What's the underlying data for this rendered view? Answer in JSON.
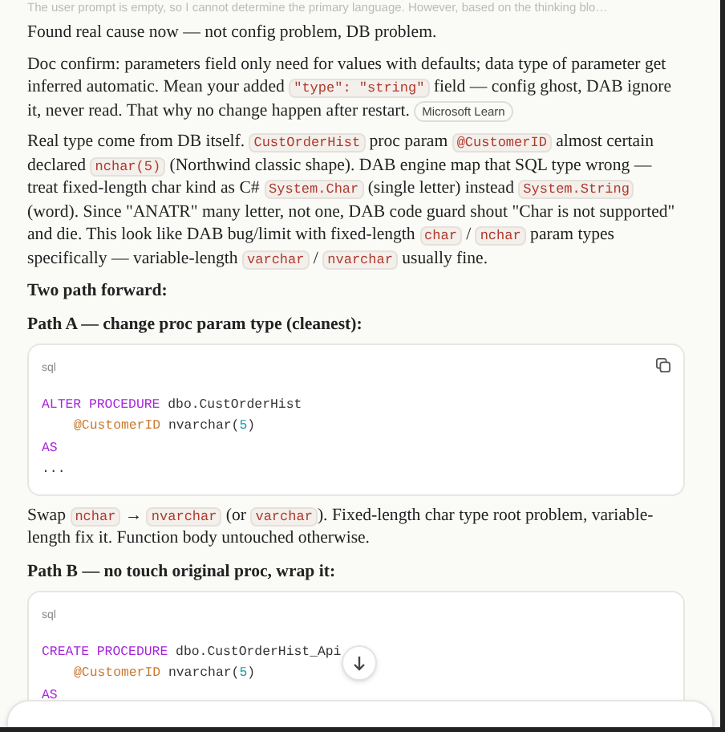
{
  "faded_line": "The user prompt is empty, so I cannot determine the primary language. However, based on the thinking blo…",
  "blocks": [
    {
      "kind": "para",
      "segments": [
        {
          "kind": "text",
          "text": "Found real cause now — not config problem, DB problem."
        }
      ]
    },
    {
      "kind": "para",
      "segments": [
        {
          "kind": "text",
          "text": "Doc confirm: parameters field only need for values with defaults; data type of parameter get inferred automatic. Mean your added "
        },
        {
          "kind": "code",
          "text": "\"type\": \"string\""
        },
        {
          "kind": "text",
          "text": " field — config ghost, DAB ignore it, never read. That why no change happen after restart. "
        },
        {
          "kind": "source",
          "text": "Microsoft Learn"
        }
      ]
    },
    {
      "kind": "para",
      "segments": [
        {
          "kind": "text",
          "text": "Real type come from DB itself. "
        },
        {
          "kind": "code",
          "text": "CustOrderHist"
        },
        {
          "kind": "text",
          "text": " proc param "
        },
        {
          "kind": "code",
          "text": "@CustomerID"
        },
        {
          "kind": "text",
          "text": " almost certain declared "
        },
        {
          "kind": "code",
          "text": "nchar(5)"
        },
        {
          "kind": "text",
          "text": " (Northwind classic shape). DAB engine map that SQL type wrong — treat fixed-length char kind as C# "
        },
        {
          "kind": "code",
          "text": "System.Char"
        },
        {
          "kind": "text",
          "text": " (single letter) instead "
        },
        {
          "kind": "code",
          "text": "System.String"
        },
        {
          "kind": "text",
          "text": " (word). Since \"ANATR\" many letter, not one, DAB code guard shout \"Char is not supported\" and die. This look like DAB bug/limit with fixed-length "
        },
        {
          "kind": "code",
          "text": "char"
        },
        {
          "kind": "text",
          "text": " / "
        },
        {
          "kind": "code",
          "text": "nchar"
        },
        {
          "kind": "text",
          "text": " param types specifically — variable-length "
        },
        {
          "kind": "code",
          "text": "varchar"
        },
        {
          "kind": "text",
          "text": " / "
        },
        {
          "kind": "code",
          "text": "nvarchar"
        },
        {
          "kind": "text",
          "text": " usually fine."
        }
      ]
    },
    {
      "kind": "heading",
      "text": "Two path forward:"
    },
    {
      "kind": "heading",
      "text": "Path A — change proc param type (cleanest):"
    },
    {
      "kind": "code_block",
      "language": "sql",
      "copy": true,
      "lines": [
        {
          "indent": false,
          "tokens": [
            {
              "kind": "keyword",
              "text": "ALTER PROCEDURE"
            },
            {
              "kind": "plain",
              "text": " dbo.CustOrderHist"
            }
          ]
        },
        {
          "indent": true,
          "tokens": [
            {
              "kind": "param",
              "text": "@CustomerID"
            },
            {
              "kind": "plain",
              "text": " nvarchar("
            },
            {
              "kind": "number",
              "text": "5"
            },
            {
              "kind": "plain",
              "text": ")"
            }
          ]
        },
        {
          "indent": false,
          "tokens": [
            {
              "kind": "keyword",
              "text": "AS"
            }
          ]
        },
        {
          "indent": false,
          "tokens": [
            {
              "kind": "plain",
              "text": "..."
            }
          ]
        }
      ]
    },
    {
      "kind": "para",
      "segments": [
        {
          "kind": "text",
          "text": "Swap "
        },
        {
          "kind": "code",
          "text": "nchar"
        },
        {
          "kind": "text",
          "text": " → "
        },
        {
          "kind": "code",
          "text": "nvarchar"
        },
        {
          "kind": "text",
          "text": " (or "
        },
        {
          "kind": "code",
          "text": "varchar"
        },
        {
          "kind": "text",
          "text": "). Fixed-length char type root problem, variable-length fix it. Function body untouched otherwise."
        }
      ]
    },
    {
      "kind": "heading",
      "text": "Path B — no touch original proc, wrap it:"
    },
    {
      "kind": "code_block",
      "language": "sql",
      "copy": false,
      "lines": [
        {
          "indent": false,
          "tokens": [
            {
              "kind": "keyword",
              "text": "CREATE PROCEDURE"
            },
            {
              "kind": "plain",
              "text": " dbo.CustOrderHist_Api"
            }
          ]
        },
        {
          "indent": true,
          "tokens": [
            {
              "kind": "param",
              "text": "@CustomerID"
            },
            {
              "kind": "plain",
              "text": " nvarchar("
            },
            {
              "kind": "number",
              "text": "5"
            },
            {
              "kind": "plain",
              "text": ")"
            }
          ]
        },
        {
          "indent": false,
          "tokens": [
            {
              "kind": "keyword",
              "text": "AS"
            }
          ]
        }
      ]
    }
  ]
}
